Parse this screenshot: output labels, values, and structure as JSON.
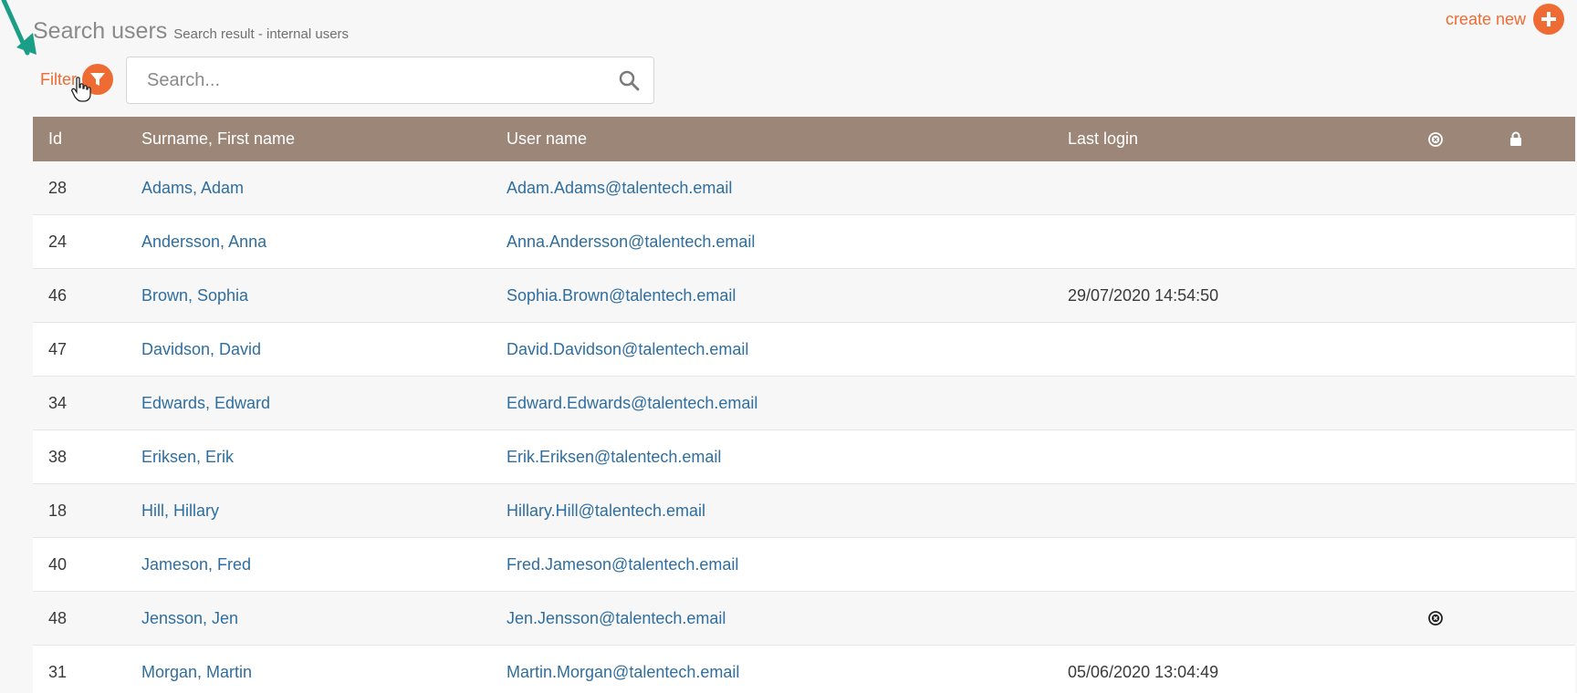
{
  "header": {
    "title": "Search users",
    "subtitle": "Search result - internal users",
    "create_new_label": "create new"
  },
  "filter": {
    "label": "Filter"
  },
  "search": {
    "placeholder": "Search...",
    "value": ""
  },
  "table": {
    "columns": {
      "id": "Id",
      "name": "Surname, First name",
      "username": "User name",
      "last_login": "Last login"
    },
    "rows": [
      {
        "id": "28",
        "name": "Adams, Adam",
        "username": "Adam.Adams@talentech.email",
        "last_login": "",
        "flagged": false
      },
      {
        "id": "24",
        "name": "Andersson, Anna",
        "username": "Anna.Andersson@talentech.email",
        "last_login": "",
        "flagged": false
      },
      {
        "id": "46",
        "name": "Brown, Sophia",
        "username": "Sophia.Brown@talentech.email",
        "last_login": "29/07/2020 14:54:50",
        "flagged": false
      },
      {
        "id": "47",
        "name": "Davidson, David",
        "username": "David.Davidson@talentech.email",
        "last_login": "",
        "flagged": false
      },
      {
        "id": "34",
        "name": "Edwards, Edward",
        "username": "Edward.Edwards@talentech.email",
        "last_login": "",
        "flagged": false
      },
      {
        "id": "38",
        "name": "Eriksen, Erik",
        "username": "Erik.Eriksen@talentech.email",
        "last_login": "",
        "flagged": false
      },
      {
        "id": "18",
        "name": "Hill, Hillary",
        "username": "Hillary.Hill@talentech.email",
        "last_login": "",
        "flagged": false
      },
      {
        "id": "40",
        "name": "Jameson, Fred",
        "username": "Fred.Jameson@talentech.email",
        "last_login": "",
        "flagged": false
      },
      {
        "id": "48",
        "name": "Jensson, Jen",
        "username": "Jen.Jensson@talentech.email",
        "last_login": "",
        "flagged": true
      },
      {
        "id": "31",
        "name": "Morgan, Martin",
        "username": "Martin.Morgan@talentech.email",
        "last_login": "05/06/2020 13:04:49",
        "flagged": false
      }
    ]
  },
  "colors": {
    "accent": "#ee6b33",
    "header_bg": "#9b8677",
    "link": "#2f6e9f",
    "annotation_arrow": "#1a9e86"
  },
  "icons": {
    "create_new": "plus-circle-icon",
    "filter": "funnel-icon",
    "search": "search-icon",
    "flag_column": "circle-x-icon",
    "lock_column": "lock-icon"
  }
}
